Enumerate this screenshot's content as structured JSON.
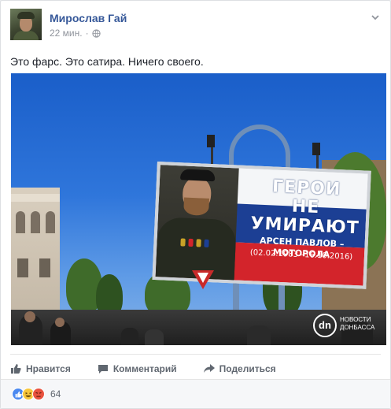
{
  "post": {
    "author": "Мирослав Гай",
    "time": "22 мин.",
    "separator": "·",
    "text": "Это фарс. Это сатира. Ничего своего."
  },
  "photo": {
    "billboard_headline": "ГЕРОИ\nНЕ УМИРАЮТ",
    "billboard_name": "АРСЕН ПАВЛОВ – МОТОРОЛА",
    "billboard_dates": "(02.02.1983 –16.10.2016)",
    "watermark_logo": "dn",
    "watermark_text": "НОВОСТИ ДОНБАССА",
    "flag_colors": [
      "#f4f6f8",
      "#1c3f94",
      "#d3242b"
    ]
  },
  "actions": {
    "like": "Нравится",
    "comment": "Комментарий",
    "share": "Поделиться"
  },
  "reactions": {
    "types": [
      "like-icon",
      "haha-icon",
      "angry-icon"
    ],
    "count": "64"
  },
  "colors": {
    "link": "#365899",
    "muted": "#90949c",
    "action": "#606770"
  }
}
